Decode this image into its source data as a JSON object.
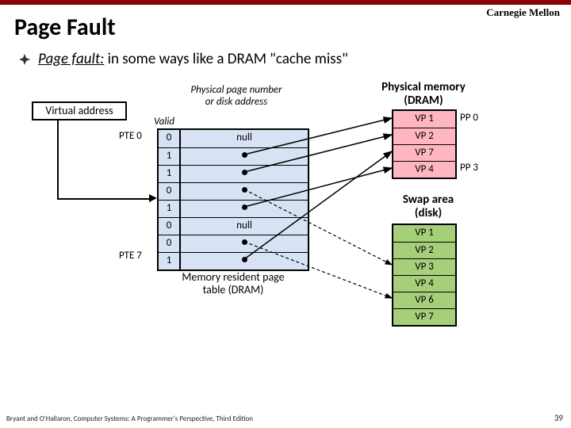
{
  "branding": {
    "cmu": "Carnegie Mellon"
  },
  "title": "Page Fault",
  "bullet": {
    "emph": "Page fault:",
    "rest": " in some ways like a DRAM \"cache miss\""
  },
  "diagram": {
    "virtual_address": "Virtual address",
    "pte_first": "PTE 0",
    "pte_last": "PTE 7",
    "col_valid": "Valid",
    "col_phys": "Physical page number or disk address",
    "mem_res": "Memory resident page table (DRAM)",
    "ptable": [
      {
        "valid": "0",
        "addr": "null",
        "dot": false
      },
      {
        "valid": "1",
        "addr": "",
        "dot": true
      },
      {
        "valid": "1",
        "addr": "",
        "dot": true
      },
      {
        "valid": "0",
        "addr": "",
        "dot": true
      },
      {
        "valid": "1",
        "addr": "",
        "dot": true
      },
      {
        "valid": "0",
        "addr": "null",
        "dot": false
      },
      {
        "valid": "0",
        "addr": "",
        "dot": true
      },
      {
        "valid": "1",
        "addr": "",
        "dot": true
      }
    ],
    "pm_header": "Physical memory (DRAM)",
    "pm": [
      "VP 1",
      "VP 2",
      "VP 7",
      "VP 4"
    ],
    "pp0": "PP 0",
    "pp3": "PP 3",
    "swap_header": "Swap area (disk)",
    "swap": [
      "VP 1",
      "VP 2",
      "VP 3",
      "VP 4",
      "VP 6",
      "VP 7"
    ]
  },
  "footer": "Bryant and O'Hallaron, Computer Systems: A Programmer's Perspective, Third Edition",
  "page_num": "39"
}
